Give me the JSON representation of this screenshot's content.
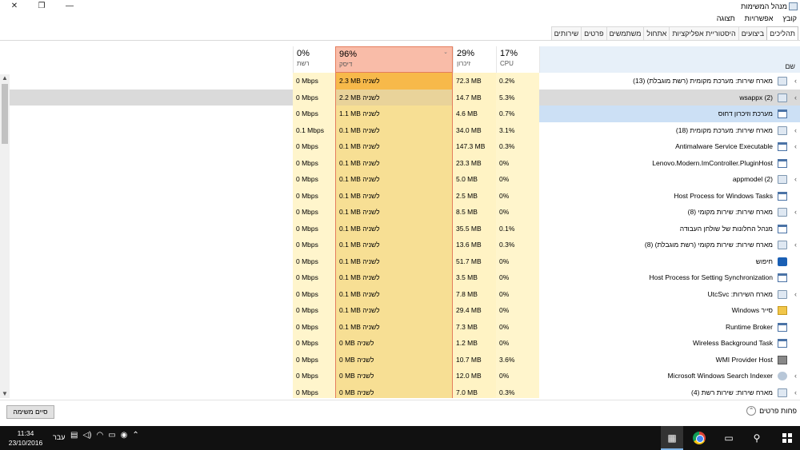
{
  "window": {
    "title": "מנהל המשימות",
    "close": "✕",
    "restore": "❐",
    "minimize": "—"
  },
  "menu": [
    "קובץ",
    "אפשרויות",
    "תצוגה"
  ],
  "tabs": [
    {
      "label": "תהליכים",
      "active": true
    },
    {
      "label": "ביצועים"
    },
    {
      "label": "היסטוריית אפליקציות"
    },
    {
      "label": "אתחול"
    },
    {
      "label": "משתמשים"
    },
    {
      "label": "פרטים"
    },
    {
      "label": "שירותים"
    }
  ],
  "columns": {
    "name": {
      "label": "שם"
    },
    "cpu": {
      "pct": "17%",
      "label": "CPU"
    },
    "memory": {
      "pct": "29%",
      "label": "זיכרון"
    },
    "disk": {
      "pct": "96%",
      "label": "דיסק"
    },
    "network": {
      "pct": "0%",
      "label": "רשת"
    }
  },
  "rows": [
    {
      "name": "מארח שירות: מערכת מקומית (רשת מוגבלת) (13)",
      "icon": "gear-icon",
      "expandable": true,
      "cpu": "0.2%",
      "mem": "72.3 MB",
      "disk": "2.3 MB לשניה",
      "net": "0 Mbps",
      "diskhot": "#f7b94a"
    },
    {
      "name": "wsappx (2)",
      "icon": "gear-icon",
      "expandable": true,
      "cpu": "5.3%",
      "mem": "14.7 MB",
      "disk": "2.2 MB לשניה",
      "net": "0 Mbps",
      "state": "hover"
    },
    {
      "name": "מערכת וזיכרון דחוס",
      "icon": "window-icon",
      "expandable": false,
      "cpu": "0.7%",
      "mem": "4.6 MB",
      "disk": "1.1 MB לשניה",
      "net": "0 Mbps",
      "state": "selected"
    },
    {
      "name": "מארח שירות: מערכת מקומית (18)",
      "icon": "gear-icon",
      "expandable": true,
      "cpu": "3.1%",
      "mem": "34.0 MB",
      "disk": "0.1 MB לשניה",
      "net": "0.1 Mbps"
    },
    {
      "name": "Antimalware Service Executable",
      "icon": "window-icon",
      "expandable": true,
      "cpu": "0.3%",
      "mem": "147.3 MB",
      "disk": "0.1 MB לשניה",
      "net": "0 Mbps"
    },
    {
      "name": "Lenovo.Modern.ImController.PluginHost",
      "icon": "window-icon",
      "expandable": false,
      "cpu": "0%",
      "mem": "23.3 MB",
      "disk": "0.1 MB לשניה",
      "net": "0 Mbps"
    },
    {
      "name": "appmodel (2)",
      "icon": "gear-icon",
      "expandable": true,
      "cpu": "0%",
      "mem": "5.0 MB",
      "disk": "0.1 MB לשניה",
      "net": "0 Mbps"
    },
    {
      "name": "Host Process for Windows Tasks",
      "icon": "window-icon",
      "expandable": false,
      "cpu": "0%",
      "mem": "2.5 MB",
      "disk": "0.1 MB לשניה",
      "net": "0 Mbps"
    },
    {
      "name": "מארח שירות: שירות מקומי (8)",
      "icon": "gear-icon",
      "expandable": true,
      "cpu": "0%",
      "mem": "8.5 MB",
      "disk": "0.1 MB לשניה",
      "net": "0 Mbps"
    },
    {
      "name": "מנהל החלונות של שולחן העבודה",
      "icon": "window-icon",
      "expandable": false,
      "cpu": "0.1%",
      "mem": "35.5 MB",
      "disk": "0.1 MB לשניה",
      "net": "0 Mbps"
    },
    {
      "name": "מארח שירות: שירות מקומי (רשת מוגבלת) (8)",
      "icon": "gear-icon",
      "expandable": true,
      "cpu": "0.3%",
      "mem": "13.6 MB",
      "disk": "0.1 MB לשניה",
      "net": "0 Mbps"
    },
    {
      "name": "חיפוש",
      "icon": "search-icon",
      "expandable": false,
      "cpu": "0%",
      "mem": "51.7 MB",
      "disk": "0.1 MB לשניה",
      "net": "0 Mbps"
    },
    {
      "name": "Host Process for Setting Synchronization",
      "icon": "window-icon",
      "expandable": false,
      "cpu": "0%",
      "mem": "3.5 MB",
      "disk": "0.1 MB לשניה",
      "net": "0 Mbps"
    },
    {
      "name": "מארח השירות: UtcSvc",
      "icon": "gear-icon",
      "expandable": true,
      "cpu": "0%",
      "mem": "7.8 MB",
      "disk": "0.1 MB לשניה",
      "net": "0 Mbps"
    },
    {
      "name": "סייר Windows",
      "icon": "folder-icon",
      "expandable": false,
      "cpu": "0%",
      "mem": "29.4 MB",
      "disk": "0.1 MB לשניה",
      "net": "0 Mbps"
    },
    {
      "name": "Runtime Broker",
      "icon": "window-icon",
      "expandable": false,
      "cpu": "0%",
      "mem": "7.3 MB",
      "disk": "0.1 MB לשניה",
      "net": "0 Mbps"
    },
    {
      "name": "Wireless Background Task",
      "icon": "window-icon",
      "expandable": false,
      "cpu": "0%",
      "mem": "1.2 MB",
      "disk": "0 MB לשניה",
      "net": "0 Mbps"
    },
    {
      "name": "WMI Provider Host",
      "icon": "wmi-icon",
      "expandable": false,
      "cpu": "3.6%",
      "mem": "10.7 MB",
      "disk": "0 MB לשניה",
      "net": "0 Mbps"
    },
    {
      "name": "Microsoft Windows Search Indexer",
      "icon": "user-icon",
      "expandable": true,
      "cpu": "0%",
      "mem": "12.0 MB",
      "disk": "0 MB לשניה",
      "net": "0 Mbps"
    },
    {
      "name": "מארח שירות: שירות רשת (4)",
      "icon": "gear-icon",
      "expandable": true,
      "cpu": "0.3%",
      "mem": "7.0 MB",
      "disk": "0 MB לשניה",
      "net": "0 Mbps"
    }
  ],
  "footer": {
    "fewer_details": "פחות פרטים",
    "end_task": "סיים משימה"
  },
  "taskbar": {
    "time": "11:34",
    "date": "23/10/2016",
    "lang": "עבר"
  },
  "colors": {
    "disk_header": "#f9bca8",
    "disk_border": "#e57d5d",
    "disk_cell": "#f7df94",
    "cell_light": "#fff5cc",
    "taskbar": "#111111"
  }
}
